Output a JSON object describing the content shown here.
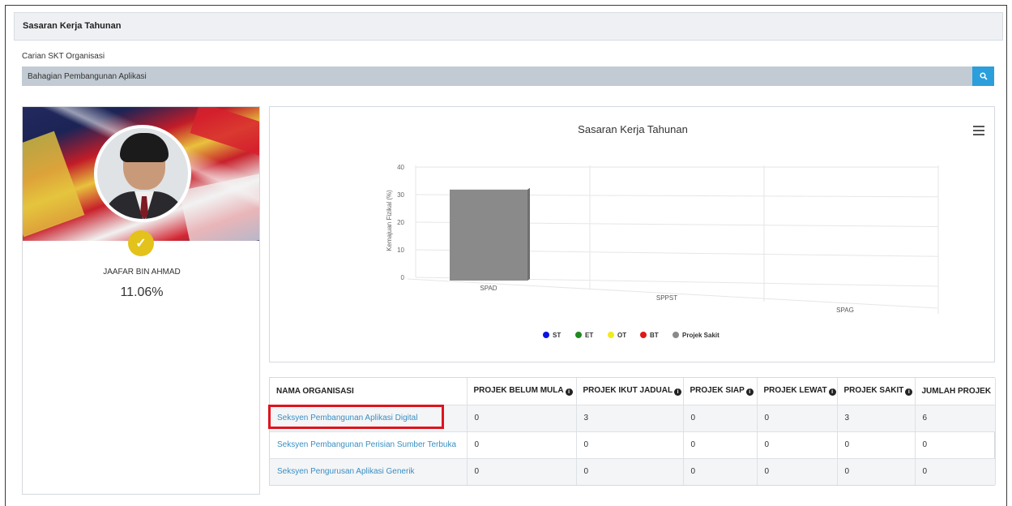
{
  "panel": {
    "title": "Sasaran Kerja Tahunan"
  },
  "search": {
    "label": "Carian SKT Organisasi",
    "value": "Bahagian Pembangunan Aplikasi",
    "button_icon": "search-icon"
  },
  "profile": {
    "name": "JAAFAR BIN AHMAD",
    "percentage": "11.06%",
    "badge_icon": "check-icon"
  },
  "chart_data": {
    "type": "bar",
    "title": "Sasaran Kerja Tahunan",
    "ylabel": "Kemajuan Fizikal (%)",
    "xlabel": "",
    "ylim": [
      0,
      40
    ],
    "yticks": [
      0,
      10,
      20,
      30,
      40
    ],
    "categories": [
      "SPAD",
      "SPPST",
      "SPAG"
    ],
    "series": [
      {
        "name": "ST",
        "color": "#0a14e0",
        "values": [
          0,
          0,
          0
        ]
      },
      {
        "name": "ET",
        "color": "#1f8a1f",
        "values": [
          0,
          0,
          0
        ]
      },
      {
        "name": "OT",
        "color": "#f2ea1c",
        "values": [
          0,
          0,
          0
        ]
      },
      {
        "name": "BT",
        "color": "#e01818",
        "values": [
          0,
          0,
          0
        ]
      },
      {
        "name": "Projek Sakit",
        "color": "#8a8a8a",
        "values": [
          33,
          0,
          0
        ]
      }
    ],
    "legend_position": "bottom",
    "grid": true,
    "style": "3d"
  },
  "table": {
    "headers": [
      "NAMA ORGANISASI",
      "PROJEK BELUM MULA",
      "PROJEK IKUT JADUAL",
      "PROJEK SIAP",
      "PROJEK LEWAT",
      "PROJEK SAKIT",
      "JUMLAH PROJEK"
    ],
    "rows": [
      [
        "Seksyen Pembangunan Aplikasi Digital",
        "0",
        "3",
        "0",
        "0",
        "3",
        "6"
      ],
      [
        "Seksyen Pembangunan Perisian Sumber Terbuka",
        "0",
        "0",
        "0",
        "0",
        "0",
        "0"
      ],
      [
        "Seksyen Pengurusan Aplikasi Generik",
        "0",
        "0",
        "0",
        "0",
        "0",
        "0"
      ]
    ]
  },
  "colors": {
    "accent": "#2a9fdc",
    "highlight": "#e0141e",
    "link": "#3a8fc2",
    "badge": "#e3c21b"
  }
}
